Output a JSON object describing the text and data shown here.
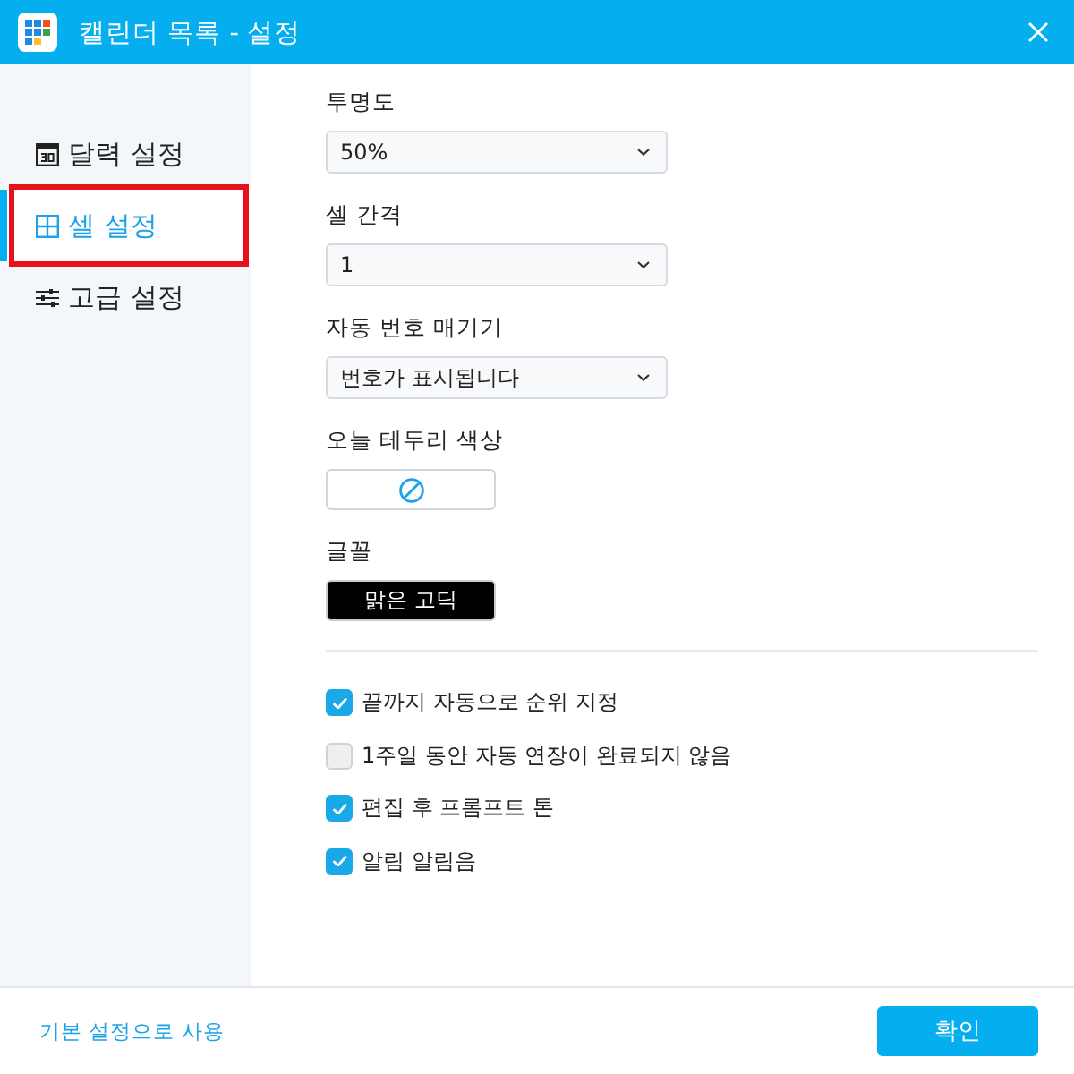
{
  "window": {
    "title": "캘린더 목록 - 설정"
  },
  "sidebar": {
    "items": [
      {
        "label": "달력 설정",
        "selected": false,
        "highlighted": false
      },
      {
        "label": "셀 설정",
        "selected": true,
        "highlighted": true
      },
      {
        "label": "고급 설정",
        "selected": false,
        "highlighted": false
      }
    ]
  },
  "settings": [
    {
      "kind": "select",
      "label": "투명도",
      "value": "50%"
    },
    {
      "kind": "select",
      "label": "셀 간격",
      "value": "1"
    },
    {
      "kind": "select",
      "label": "자동 번호 매기기",
      "value": "번호가 표시됩니다"
    },
    {
      "kind": "color",
      "label": "오늘 테두리 색상"
    },
    {
      "kind": "font",
      "label": "글꼴",
      "value": "맑은 고딕"
    }
  ],
  "options": [
    {
      "label": "끝까지 자동으로 순위 지정",
      "checked": true
    },
    {
      "label": "1주일 동안 자동 연장이 완료되지 않음",
      "checked": false
    },
    {
      "label": "편집 후 프롬프트 톤",
      "checked": true
    },
    {
      "label": "알림 알림음",
      "checked": true
    }
  ],
  "footer": {
    "link": "기본 설정으로 사용",
    "button": "확인"
  }
}
